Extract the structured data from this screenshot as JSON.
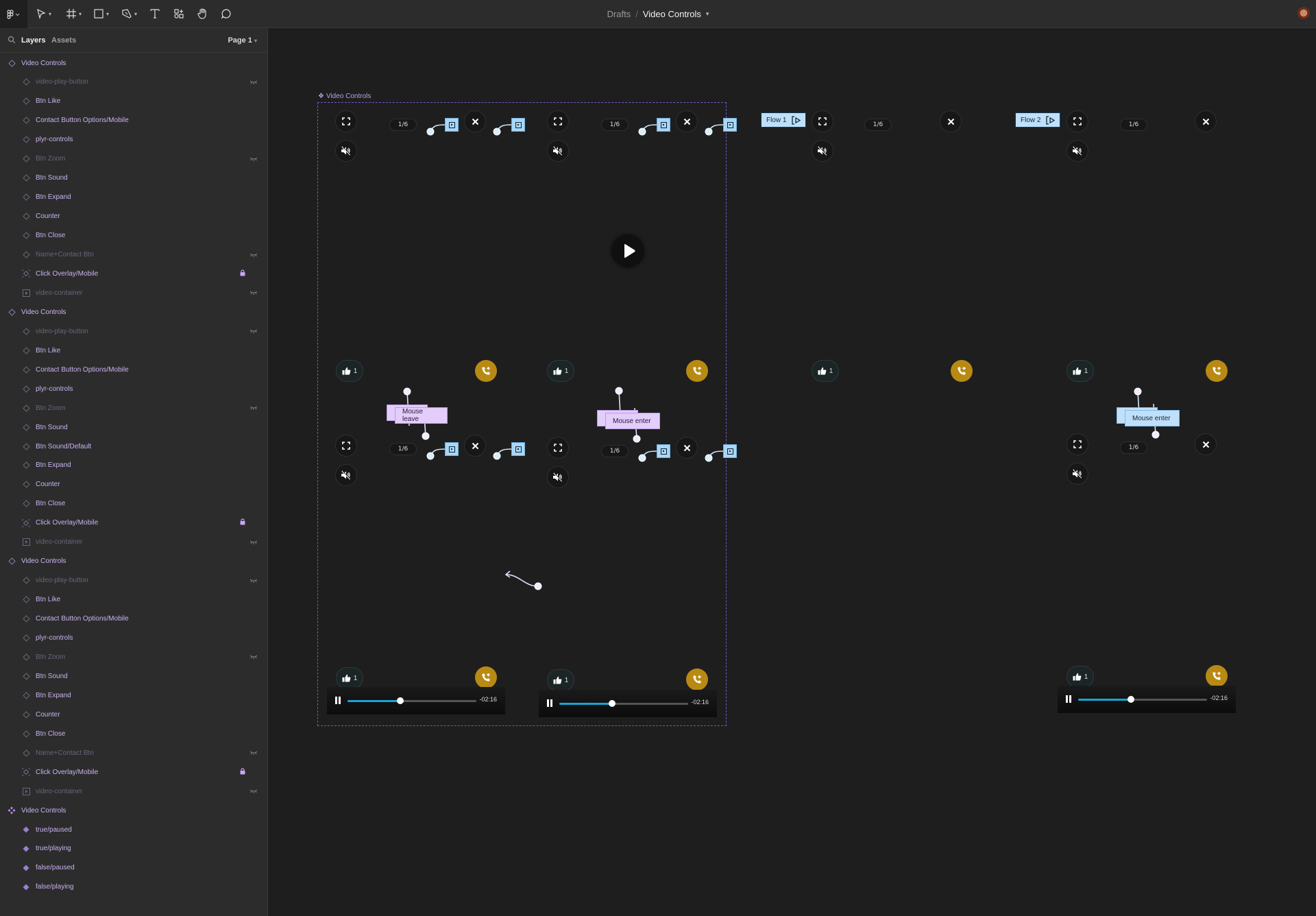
{
  "topbar": {
    "tools": [
      "main-menu",
      "move-tool",
      "frame-tool",
      "shape-tool",
      "pen-tool",
      "text-tool",
      "resources-tool",
      "hand-tool",
      "comment-tool"
    ],
    "breadcrumb_parent": "Drafts",
    "breadcrumb_separator": "/",
    "file_title": "Video Controls"
  },
  "sidebar": {
    "tab_layers": "Layers",
    "tab_assets": "Assets",
    "page_selector": "Page 1",
    "groups": [
      {
        "name": "Video Controls",
        "icon": "component-variant-icon",
        "children": [
          {
            "name": "video-play-button",
            "icon": "instance-icon",
            "hidden": true
          },
          {
            "name": "Btn Like",
            "icon": "instance-icon"
          },
          {
            "name": "Contact Button Options/Mobile",
            "icon": "instance-icon"
          },
          {
            "name": "plyr-controls",
            "icon": "instance-icon"
          },
          {
            "name": "Btn Zoom",
            "icon": "instance-icon",
            "hidden": true
          },
          {
            "name": "Btn Sound",
            "icon": "instance-icon"
          },
          {
            "name": "Btn Expand",
            "icon": "instance-icon"
          },
          {
            "name": "Counter",
            "icon": "instance-icon"
          },
          {
            "name": "Btn Close",
            "icon": "instance-icon"
          },
          {
            "name": "Name+Contact Btn",
            "icon": "instance-icon",
            "hidden": true
          },
          {
            "name": "Click Overlay/Mobile",
            "icon": "overlay-instance-icon",
            "locked": true
          },
          {
            "name": "video-container",
            "icon": "video-frame-icon",
            "hidden": true
          }
        ]
      },
      {
        "name": "Video Controls",
        "icon": "component-variant-icon",
        "children": [
          {
            "name": "video-play-button",
            "icon": "instance-icon",
            "hidden": true
          },
          {
            "name": "Btn Like",
            "icon": "instance-icon"
          },
          {
            "name": "Contact Button Options/Mobile",
            "icon": "instance-icon"
          },
          {
            "name": "plyr-controls",
            "icon": "instance-icon"
          },
          {
            "name": "Btn Zoom",
            "icon": "instance-icon",
            "hidden": true
          },
          {
            "name": "Btn Sound",
            "icon": "instance-icon"
          },
          {
            "name": "Btn Sound/Default",
            "icon": "instance-icon"
          },
          {
            "name": "Btn Expand",
            "icon": "instance-icon"
          },
          {
            "name": "Counter",
            "icon": "instance-icon"
          },
          {
            "name": "Btn Close",
            "icon": "instance-icon"
          },
          {
            "name": "Click Overlay/Mobile",
            "icon": "overlay-instance-icon",
            "locked": true
          },
          {
            "name": "video-container",
            "icon": "video-frame-icon",
            "hidden": true
          }
        ]
      },
      {
        "name": "Video Controls",
        "icon": "component-variant-icon",
        "children": [
          {
            "name": "video-play-button",
            "icon": "instance-icon",
            "hidden": true
          },
          {
            "name": "Btn Like",
            "icon": "instance-icon"
          },
          {
            "name": "Contact Button Options/Mobile",
            "icon": "instance-icon"
          },
          {
            "name": "plyr-controls",
            "icon": "instance-icon"
          },
          {
            "name": "Btn Zoom",
            "icon": "instance-icon",
            "hidden": true
          },
          {
            "name": "Btn Sound",
            "icon": "instance-icon"
          },
          {
            "name": "Btn Expand",
            "icon": "instance-icon"
          },
          {
            "name": "Counter",
            "icon": "instance-icon"
          },
          {
            "name": "Btn Close",
            "icon": "instance-icon"
          },
          {
            "name": "Name+Contact Btn",
            "icon": "instance-icon",
            "hidden": true
          },
          {
            "name": "Click Overlay/Mobile",
            "icon": "overlay-instance-icon",
            "locked": true
          },
          {
            "name": "video-container",
            "icon": "video-frame-icon",
            "hidden": true
          }
        ]
      },
      {
        "name": "Video Controls",
        "icon": "component-set-icon",
        "children": [
          {
            "name": "true/paused",
            "icon": "component-icon"
          },
          {
            "name": "true/playing",
            "icon": "component-icon"
          },
          {
            "name": "false/paused",
            "icon": "component-icon"
          },
          {
            "name": "false/playing",
            "icon": "component-icon"
          }
        ]
      }
    ]
  },
  "canvas": {
    "component_set_label": "Video Controls",
    "flows": [
      "Flow 1",
      "Flow 2"
    ],
    "counter_text": "1/6",
    "like_count": "1",
    "time_remaining": "-02:16",
    "progress_fraction": 0.41,
    "triggers": {
      "a": "Mouse leave",
      "b": "Mouse enter",
      "c": "Mouse enter"
    },
    "colors": {
      "accent_purple": "#7b55c9",
      "call_gold": "#b88a14",
      "progress_blue": "#1aa3d6",
      "flow_blue": "#bfe0fa",
      "trigger_purple": "#e3cdfa"
    }
  }
}
